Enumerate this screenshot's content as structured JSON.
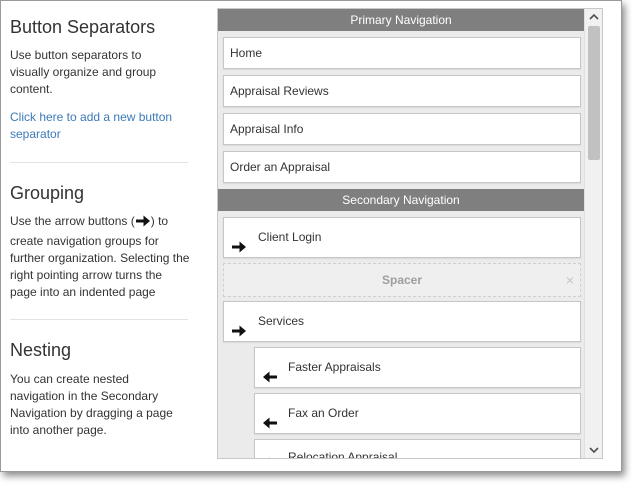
{
  "sections": {
    "separators": {
      "title": "Button Separators",
      "text": "Use button separators to visually organize and group content.",
      "link": "Click here to add a new button separator"
    },
    "grouping": {
      "title": "Grouping",
      "text_before": "Use the arrow buttons (",
      "text_after": ") to create navigation groups for further organization. Selecting the right pointing arrow turns the page into an indented page"
    },
    "nesting": {
      "title": "Nesting",
      "text": "You can create nested navigation in the Secondary Navigation by dragging a page into another page."
    }
  },
  "primary_navigation": {
    "header": "Primary Navigation",
    "items": [
      "Home",
      "Appraisal Reviews",
      "Appraisal Info",
      "Order an Appraisal"
    ]
  },
  "secondary_navigation": {
    "header": "Secondary Navigation",
    "items": [
      {
        "label": "Client Login",
        "arrow": "right-arrow-icon"
      },
      {
        "label": "Spacer",
        "type": "spacer",
        "close": "×"
      },
      {
        "label": "Services",
        "arrow": "right-arrow-icon"
      },
      {
        "label": "Faster Appraisals",
        "arrow": "left-arrow-icon",
        "nested": true
      },
      {
        "label": "Fax an Order",
        "arrow": "left-arrow-icon",
        "nested": true
      },
      {
        "label": "Relocation Appraisal",
        "arrow": "left-arrow-icon",
        "nested": true
      }
    ]
  },
  "scrollbar": {
    "up": "▲",
    "down": "▼"
  },
  "colors": {
    "header_bg": "#7f7f7f",
    "link": "#3b7ab8",
    "panel_bg": "#ebebeb"
  }
}
